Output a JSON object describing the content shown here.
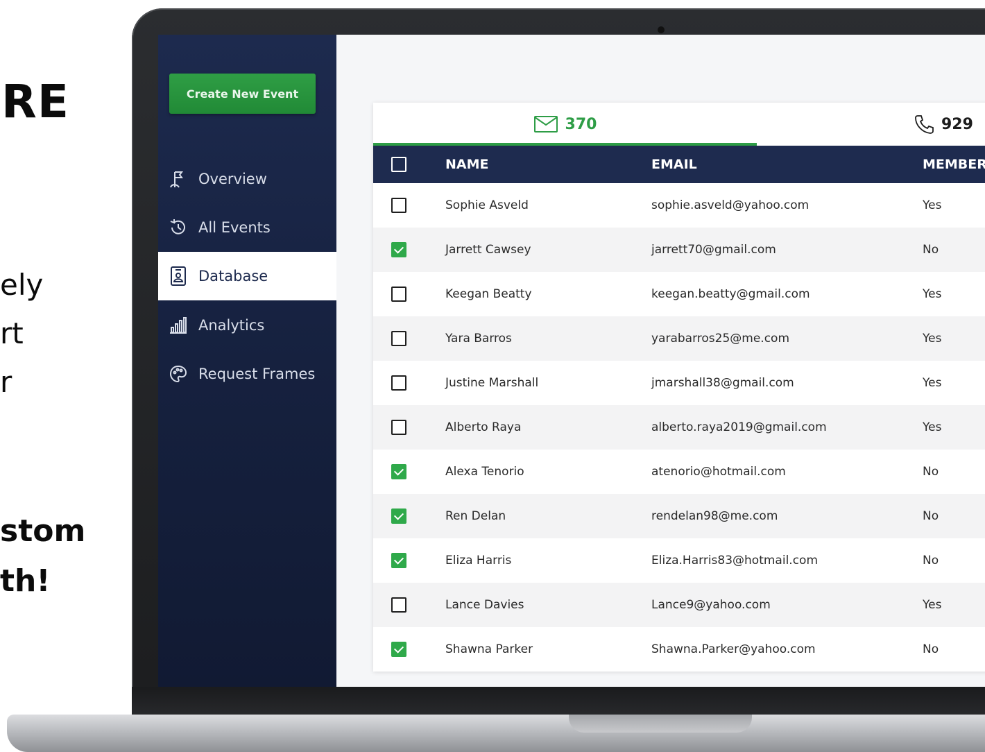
{
  "promo": {
    "line1": "RE",
    "line2": "ely",
    "line3": "rt",
    "line4": "r",
    "line5": "stom",
    "line6": "th!"
  },
  "sidebar": {
    "create_button": "Create New Event",
    "items": [
      {
        "label": "Overview",
        "icon": "flag-icon"
      },
      {
        "label": "All Events",
        "icon": "history-icon"
      },
      {
        "label": "Database",
        "icon": "contact-card-icon",
        "active": true
      },
      {
        "label": "Analytics",
        "icon": "bar-chart-icon"
      },
      {
        "label": "Request Frames",
        "icon": "palette-icon"
      }
    ]
  },
  "tabs": {
    "email_count": "370",
    "phone_count": "929"
  },
  "table": {
    "headers": {
      "name": "NAME",
      "email": "EMAIL",
      "member": "MEMBER"
    },
    "rows": [
      {
        "checked": false,
        "name": "Sophie Asveld",
        "email": "sophie.asveld@yahoo.com",
        "member": "Yes"
      },
      {
        "checked": true,
        "name": "Jarrett Cawsey",
        "email": "jarrett70@gmail.com",
        "member": "No"
      },
      {
        "checked": false,
        "name": "Keegan Beatty",
        "email": "keegan.beatty@gmail.com",
        "member": "Yes"
      },
      {
        "checked": false,
        "name": "Yara Barros",
        "email": "yarabarros25@me.com",
        "member": "Yes"
      },
      {
        "checked": false,
        "name": "Justine Marshall",
        "email": "jmarshall38@gmail.com",
        "member": "Yes"
      },
      {
        "checked": false,
        "name": "Alberto Raya",
        "email": "alberto.raya2019@gmail.com",
        "member": "Yes"
      },
      {
        "checked": true,
        "name": "Alexa Tenorio",
        "email": "atenorio@hotmail.com",
        "member": "No"
      },
      {
        "checked": true,
        "name": "Ren Delan",
        "email": "rendelan98@me.com",
        "member": "No"
      },
      {
        "checked": true,
        "name": "Eliza Harris",
        "email": "Eliza.Harris83@hotmail.com",
        "member": "No"
      },
      {
        "checked": false,
        "name": "Lance Davies",
        "email": "Lance9@yahoo.com",
        "member": "Yes"
      },
      {
        "checked": true,
        "name": "Shawna Parker",
        "email": "Shawna.Parker@yahoo.com",
        "member": "No"
      }
    ]
  },
  "colors": {
    "accent_green": "#2e9d46",
    "sidebar_navy": "#1d2a4e",
    "header_navy": "#1e2b4f"
  }
}
